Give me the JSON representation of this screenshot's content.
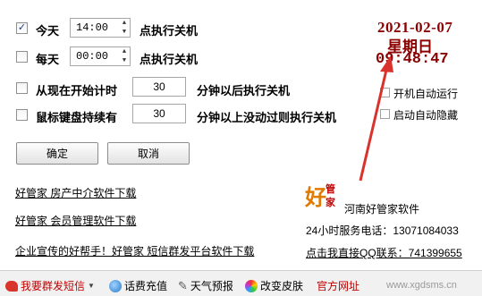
{
  "options": [
    {
      "checked": true,
      "check_mark": "✓",
      "label": "今天",
      "time": "14:00",
      "suffix": "点执行关机"
    },
    {
      "checked": false,
      "check_mark": "",
      "label": "每天",
      "time": "00:00",
      "suffix": "点执行关机"
    },
    {
      "checked": false,
      "check_mark": "",
      "label": "从现在开始计时",
      "minutes": "30",
      "suffix": "分钟以后执行关机"
    },
    {
      "checked": false,
      "check_mark": "",
      "label": "鼠标键盘持续有",
      "minutes": "30",
      "suffix": "分钟以上没动过则执行关机"
    }
  ],
  "clock": {
    "date": "2021-02-07",
    "weekday": "星期日",
    "time": "09:48:47",
    "color": "#8b0000"
  },
  "startup": {
    "autorun": "开机自动运行",
    "autohide": "启动自动隐藏"
  },
  "buttons": {
    "ok": "确定",
    "cancel": "取消"
  },
  "links": {
    "realestate": "好管家 房产中介软件下载",
    "member": "好管家 会员管理软件下载",
    "sms": "企业宣传的好帮手！好管家 短信群发平台软件下载"
  },
  "company": {
    "logo_chars": "好管家",
    "name": "河南好管家软件",
    "phone": "24小时服务电话：13071084033",
    "qq": "点击我直接QQ联系：741399655"
  },
  "footer": {
    "sms": "我要群发短信",
    "recharge": "话费充值",
    "weather": "天气预报",
    "skin": "改变皮肤",
    "website": "官方网址",
    "watermark_url": "www.xgdsms.cn"
  },
  "colors": {
    "accent_red": "#c00000",
    "arrow": "#d9342b"
  }
}
